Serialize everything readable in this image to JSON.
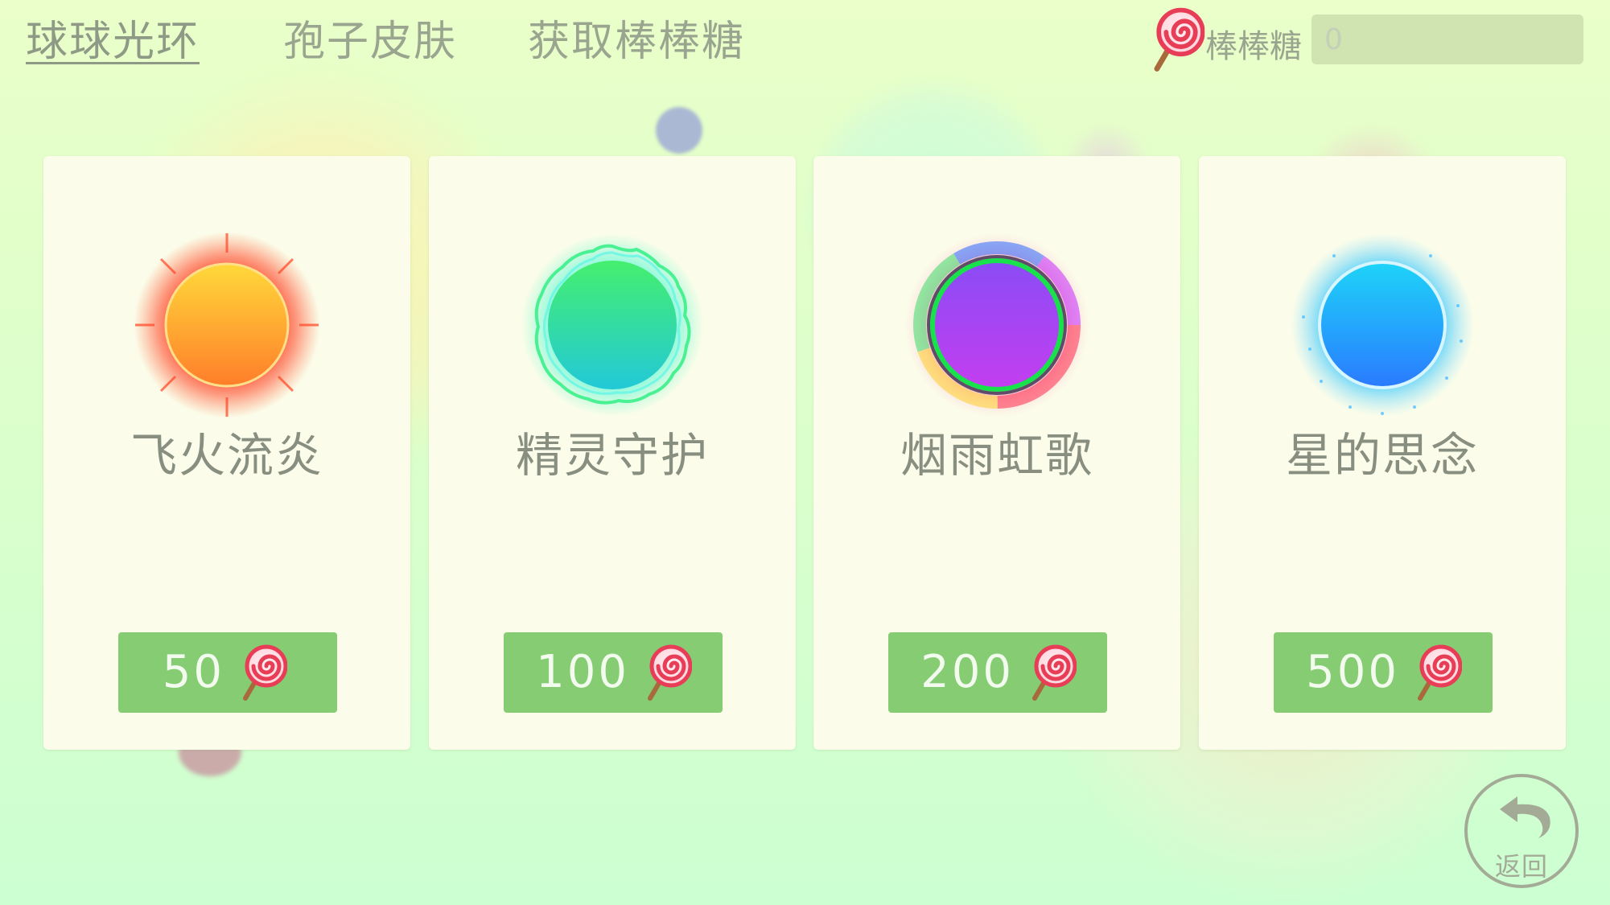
{
  "tabs": [
    {
      "label": "球球光环",
      "active": true
    },
    {
      "label": "孢子皮肤",
      "active": false
    },
    {
      "label": "获取棒棒糖",
      "active": false
    }
  ],
  "candy": {
    "label": "棒棒糖",
    "value": "0",
    "icon": "lollipop-icon"
  },
  "cards": [
    {
      "name": "飞火流炎",
      "price": "50",
      "halo": "fire-halo"
    },
    {
      "name": "精灵守护",
      "price": "100",
      "halo": "spirit-halo"
    },
    {
      "name": "烟雨虹歌",
      "price": "200",
      "halo": "rainbow-halo"
    },
    {
      "name": "星的思念",
      "price": "500",
      "halo": "star-halo"
    }
  ],
  "return_button": {
    "label": "返回",
    "icon": "return-arrow-icon"
  }
}
